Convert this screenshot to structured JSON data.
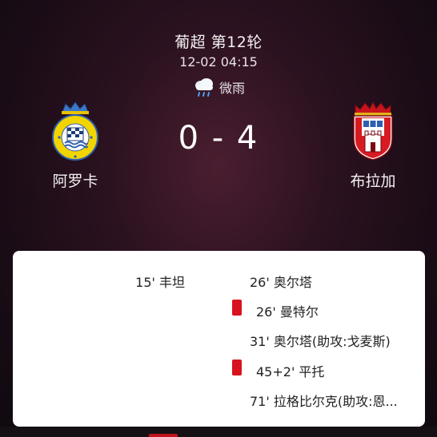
{
  "match": {
    "league": "葡超  第12轮",
    "datetime": "12-02 04:15",
    "weather": "微雨",
    "home_team": "阿罗卡",
    "away_team": "布拉加",
    "score": "0 - 4"
  },
  "events": [
    {
      "side": "home",
      "text": "15' 丰坦",
      "card": false
    },
    {
      "side": "away",
      "text": "26' 奥尔塔",
      "card": false
    },
    {
      "side": "away",
      "text": "26' 曼特尔",
      "card": true
    },
    {
      "side": "away",
      "text": "31' 奥尔塔(助攻:戈麦斯)",
      "card": false
    },
    {
      "side": "away",
      "text": "45+2' 平托",
      "card": true
    },
    {
      "side": "away",
      "text": "71' 拉格比尔克(助攻:恩...",
      "card": false
    }
  ],
  "colors": {
    "red_card": "#d7141e",
    "background": "#2c1220",
    "panel": "#ffffff"
  },
  "icons": {
    "weather": "drizzle-cloud-icon",
    "home_crest": "arouca-crest-icon",
    "away_crest": "braga-crest-icon",
    "card": "red-card-icon"
  }
}
